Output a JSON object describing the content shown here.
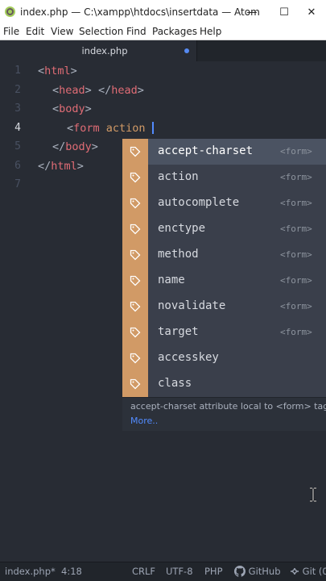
{
  "window": {
    "title": "index.php — C:\\xampp\\htdocs\\insertdata — Atom",
    "minimize": "—",
    "maximize": "☐",
    "close": "✕"
  },
  "menu": [
    "File",
    "Edit",
    "View",
    "Selection",
    "Find",
    "Packages",
    "Help"
  ],
  "tab": {
    "label": "index.php",
    "modified": true
  },
  "gutter": [
    "1",
    "2",
    "3",
    "4",
    "5",
    "6",
    "7"
  ],
  "active_line": 4,
  "code": {
    "l1": {
      "open": "<",
      "tag": "html",
      "close": ">"
    },
    "l2": {
      "open1": "<",
      "tag1": "head",
      "close1": ">",
      "open2": "</",
      "tag2": "head",
      "close2": ">"
    },
    "l3": {
      "open": "<",
      "tag": "body",
      "close": ">"
    },
    "l4": {
      "open": "<",
      "tag": "form",
      "attr": "action"
    },
    "l5": {
      "open": "</",
      "tag": "body",
      "close": ">"
    },
    "l6": {
      "open": "</",
      "tag": "html",
      "close": ">"
    }
  },
  "autocomplete": {
    "items": [
      {
        "label": "accept-charset",
        "right": "<form>"
      },
      {
        "label": "action",
        "right": "<form>"
      },
      {
        "label": "autocomplete",
        "right": "<form>"
      },
      {
        "label": "enctype",
        "right": "<form>"
      },
      {
        "label": "method",
        "right": "<form>"
      },
      {
        "label": "name",
        "right": "<form>"
      },
      {
        "label": "novalidate",
        "right": "<form>"
      },
      {
        "label": "target",
        "right": "<form>"
      },
      {
        "label": "accesskey",
        "right": ""
      },
      {
        "label": "class",
        "right": ""
      }
    ],
    "selected_index": 0,
    "description": "accept-charset attribute local to <form> tags",
    "more": "More.."
  },
  "status": {
    "file": "index.php*",
    "position": "4:18",
    "line_ending": "CRLF",
    "encoding": "UTF-8",
    "grammar": "PHP",
    "github": "GitHub",
    "git": "Git (0"
  },
  "colors": {
    "editor_bg": "#282c34",
    "tag": "#e06c75",
    "attr": "#d19a66",
    "cursor": "#528bff",
    "ac_icon": "#d19a66"
  }
}
